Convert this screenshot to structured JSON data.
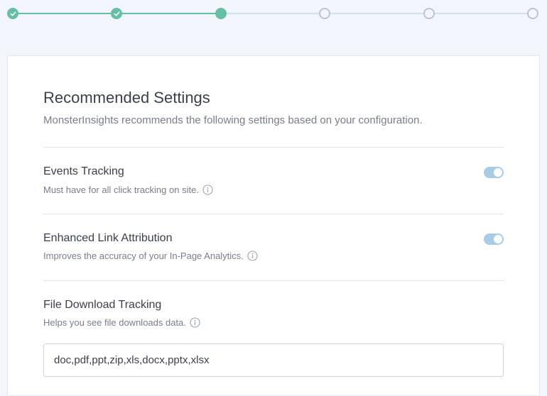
{
  "stepper": {
    "steps": [
      {
        "state": "completed",
        "icon": "check-icon"
      },
      {
        "state": "completed",
        "icon": "check-icon"
      },
      {
        "state": "current",
        "icon": ""
      },
      {
        "state": "upcoming",
        "icon": ""
      },
      {
        "state": "upcoming",
        "icon": ""
      },
      {
        "state": "upcoming",
        "icon": ""
      }
    ],
    "colors": {
      "completed": "#64bfa5",
      "upcoming": "#b9c4d1"
    }
  },
  "card": {
    "title": "Recommended Settings",
    "subtitle": "MonsterInsights recommends the following settings based on your configuration."
  },
  "settings": {
    "events_tracking": {
      "label": "Events Tracking",
      "description": "Must have for all click tracking on site.",
      "enabled": true,
      "info_icon": "info-icon"
    },
    "enhanced_link_attribution": {
      "label": "Enhanced Link Attribution",
      "description": "Improves the accuracy of your In-Page Analytics.",
      "enabled": true,
      "info_icon": "info-icon"
    },
    "file_download_tracking": {
      "label": "File Download Tracking",
      "description": "Helps you see file downloads data.",
      "value": "doc,pdf,ppt,zip,xls,docx,pptx,xlsx",
      "info_icon": "info-icon"
    }
  },
  "colors": {
    "accent": "#64bfa5",
    "toggle_on": "#a8cbe6",
    "background": "#f3f5fd"
  }
}
